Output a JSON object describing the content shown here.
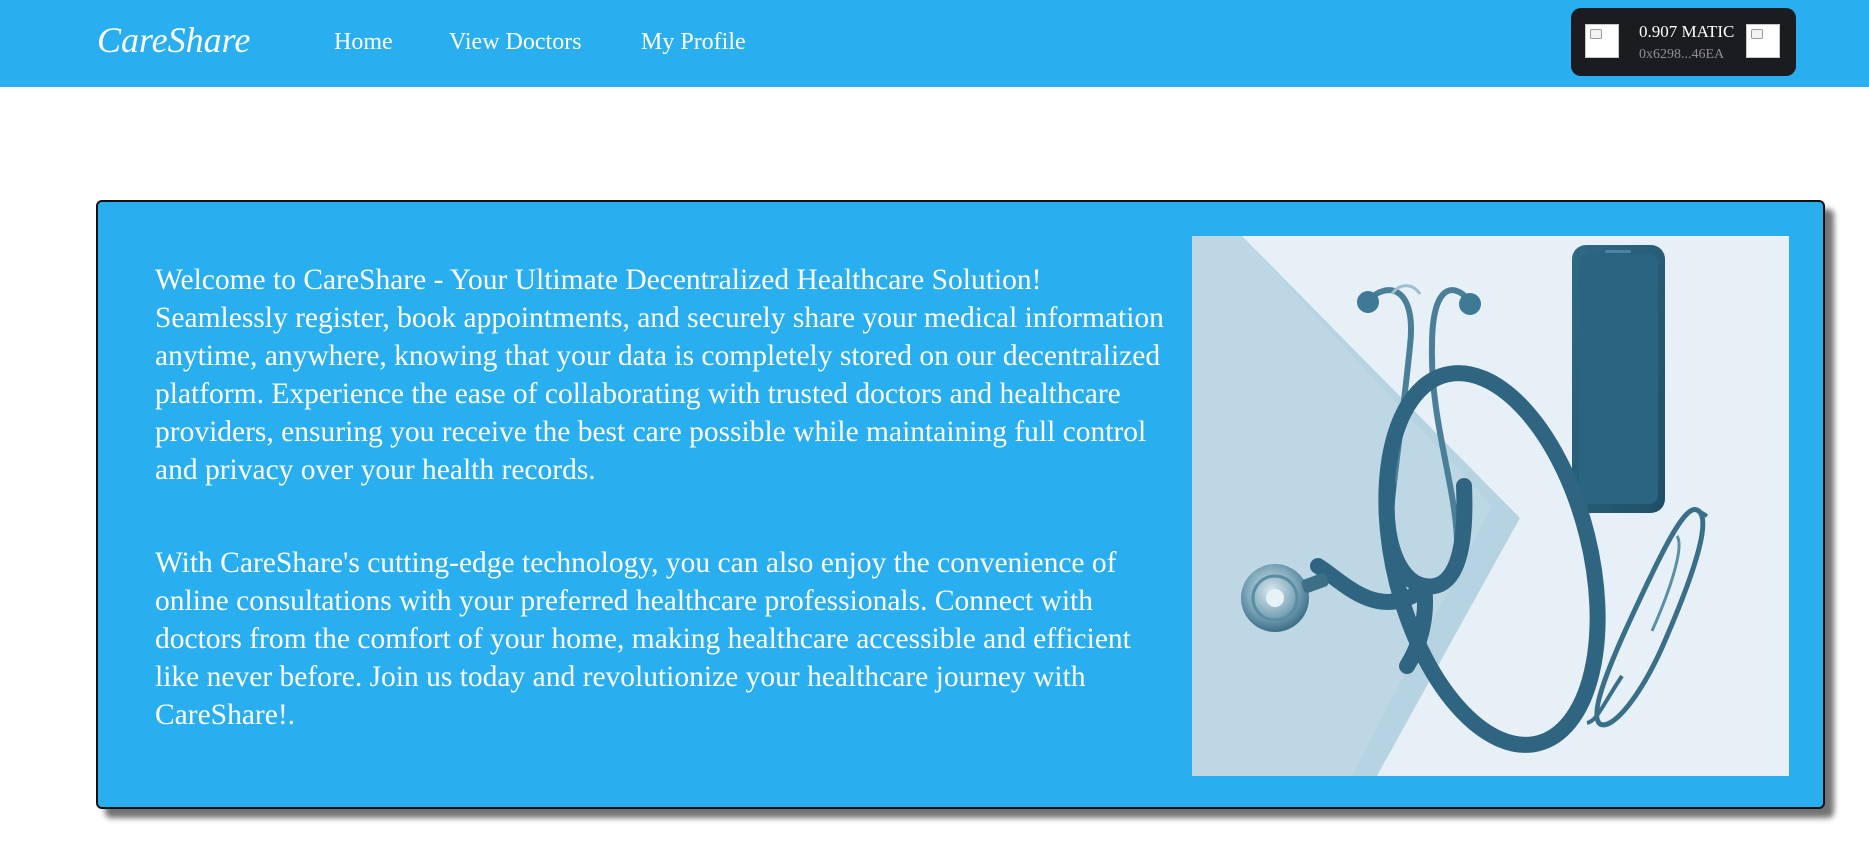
{
  "navbar": {
    "brand": "CareShare",
    "links": [
      {
        "label": "Home"
      },
      {
        "label": "View Doctors"
      },
      {
        "label": "My Profile"
      }
    ]
  },
  "wallet": {
    "balance": "0.907 MATIC",
    "address": "0x6298...46EA",
    "left_icon": "broken-image-icon",
    "right_icon": "broken-image-icon"
  },
  "hero": {
    "paragraphs": [
      "Welcome to CareShare - Your Ultimate Decentralized Healthcare Solution! Seamlessly register, book appointments, and securely share your medical information anytime, anywhere, knowing that your data is completely stored on our decentralized platform. Experience the ease of collaborating with trusted doctors and healthcare providers, ensuring you receive the best care possible while maintaining full control and privacy over your health records.",
      "With CareShare's cutting-edge technology, you can also enjoy the convenience of online consultations with your preferred healthcare professionals. Connect with doctors from the comfort of your home, making healthcare accessible and efficient like never before. Join us today and revolutionize your healthcare journey with CareShare!."
    ],
    "image_subject": "stethoscope-phone-glasses-image"
  },
  "colors": {
    "primary": "#29aef0",
    "wallet_bg": "#1b1c1f",
    "text": "#ffffff"
  }
}
